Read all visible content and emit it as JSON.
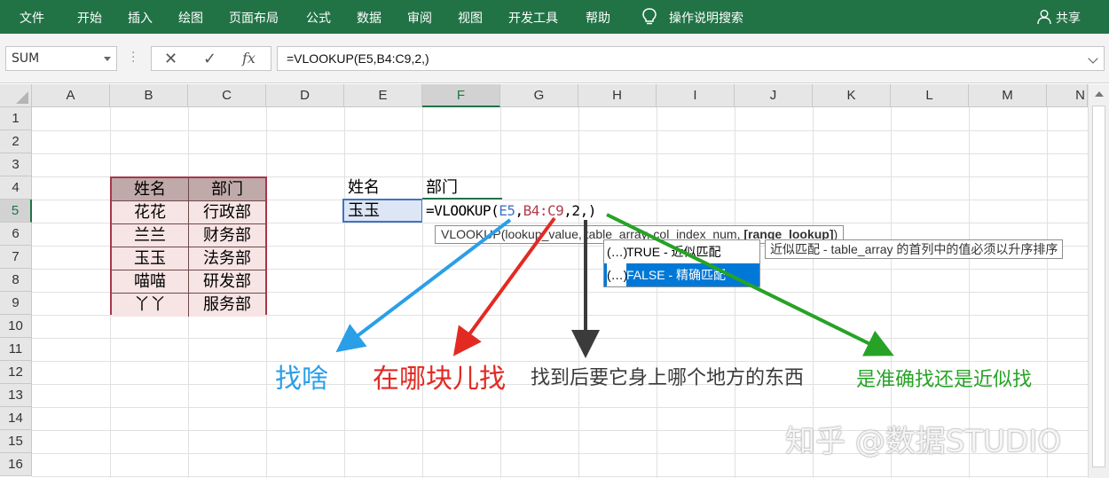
{
  "ribbon": {
    "tabs": [
      "文件",
      "开始",
      "插入",
      "绘图",
      "页面布局",
      "公式",
      "数据",
      "审阅",
      "视图",
      "开发工具",
      "帮助"
    ],
    "search_label": "操作说明搜索",
    "share_label": "共享",
    "bg_color": "#217346"
  },
  "formula_bar": {
    "name_box": "SUM",
    "cancel_icon": "✕",
    "enter_icon": "✓",
    "fx_icon": "fx",
    "formula": "=VLOOKUP(E5,B4:C9,2,)"
  },
  "sheet": {
    "columns": [
      "A",
      "B",
      "C",
      "D",
      "E",
      "F",
      "G",
      "H",
      "I",
      "J",
      "K",
      "L",
      "M",
      "N"
    ],
    "rows": [
      "1",
      "2",
      "3",
      "4",
      "5",
      "6",
      "7",
      "8",
      "9",
      "10",
      "11",
      "12",
      "13",
      "14",
      "15",
      "16"
    ],
    "selected_column": "F",
    "selected_row": "5"
  },
  "table": {
    "headers": [
      "姓名",
      "部门"
    ],
    "rows": [
      [
        "花花",
        "行政部"
      ],
      [
        "兰兰",
        "财务部"
      ],
      [
        "玉玉",
        "法务部"
      ],
      [
        "喵喵",
        "研发部"
      ],
      [
        "丫丫",
        "服务部"
      ]
    ],
    "header_bg": "#c0a9a9",
    "row_bg": "#f7e4e4",
    "border_color": "#a8364a"
  },
  "lookup": {
    "e4": "姓名",
    "f4": "部门",
    "e5": "玉玉",
    "f5_parts": {
      "prefix": "=VLOOKUP(",
      "arg1": "E5",
      "sep1": ",",
      "arg2": "B4:C9",
      "sep2": ",",
      "arg3": "2",
      "sep3": ",",
      "suffix": ")"
    }
  },
  "tooltip": {
    "text": "VLOOKUP(lookup_value, table_array, col_index_num, ",
    "bold": "[range_lookup]",
    "end": ")"
  },
  "autocomplete": {
    "items": [
      {
        "tag": "(…)",
        "label": "TRUE - 近似匹配"
      },
      {
        "tag": "(…)",
        "label": "FALSE - 精确匹配"
      }
    ],
    "highlight_color": "#0078d7"
  },
  "hint": "近似匹配 - table_array 的首列中的值必须以升序排序",
  "annotations": {
    "find_what": "找啥",
    "where": "在哪块儿找",
    "which_part": "找到后要它身上哪个地方的东西",
    "exact": "是准确找还是近似找",
    "colors": {
      "blue": "#2a9fe8",
      "red": "#e32a22",
      "dark": "#3b3b3b",
      "green": "#26a326"
    }
  },
  "watermark": "知乎 @数据STUDIO"
}
